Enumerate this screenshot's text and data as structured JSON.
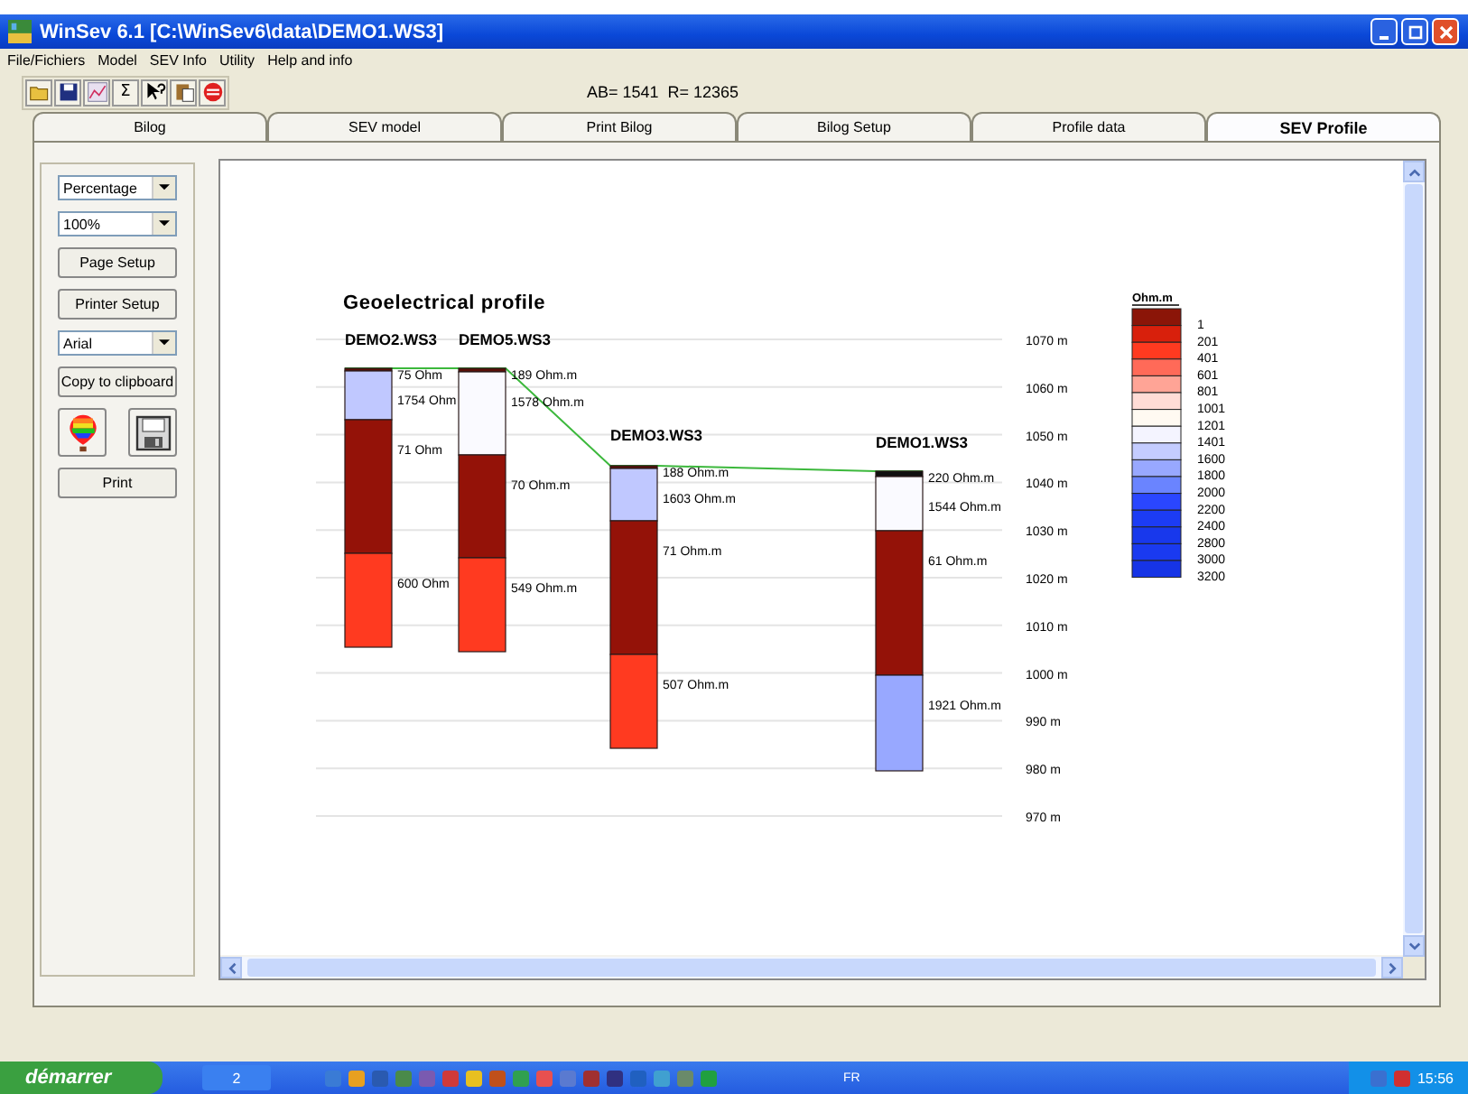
{
  "window": {
    "title": "WinSev 6.1 [C:\\WinSev6\\data\\DEMO1.WS3]"
  },
  "menu": [
    "File/Fichiers",
    "Model",
    "SEV Info",
    "Utility",
    "Help and info"
  ],
  "toolbar": {
    "sigma": "Σ",
    "readout": "AB= 1541  R= 12365"
  },
  "tabs": [
    {
      "label": "Bilog",
      "selected": false
    },
    {
      "label": "SEV model",
      "selected": false
    },
    {
      "label": "Print Bilog",
      "selected": false
    },
    {
      "label": "Bilog Setup",
      "selected": false
    },
    {
      "label": "Profile data",
      "selected": false
    },
    {
      "label": "SEV Profile",
      "selected": true
    }
  ],
  "side_panel": {
    "scale_mode": "Percentage",
    "zoom": "100%",
    "page_setup": "Page Setup",
    "printer_setup": "Printer Setup",
    "font": "Arial",
    "copy": "Copy to clipboard",
    "print": "Print"
  },
  "profile": {
    "title": "Geoelectrical profile",
    "soundings": [
      {
        "name": "DEMO2.WS3",
        "layers": [
          {
            "label": "75 Ohm",
            "color": "#5a1008"
          },
          {
            "label": "1754 Ohm",
            "color": "#c0c8ff"
          },
          {
            "label": "71 Ohm",
            "color": "#941208"
          },
          {
            "label": "600 Ohm",
            "color": "#ff3a20"
          }
        ]
      },
      {
        "name": "DEMO5.WS3",
        "layers": [
          {
            "label": "189 Ohm.m",
            "color": "#5a1008"
          },
          {
            "label": "1578 Ohm.m",
            "color": "#fafaff"
          },
          {
            "label": "70 Ohm.m",
            "color": "#941208"
          },
          {
            "label": "549 Ohm.m",
            "color": "#ff3a20"
          }
        ]
      },
      {
        "name": "DEMO3.WS3",
        "layers": [
          {
            "label": "188 Ohm.m",
            "color": "#5a1008"
          },
          {
            "label": "1603 Ohm.m",
            "color": "#c0c8ff"
          },
          {
            "label": "71 Ohm.m",
            "color": "#941208"
          },
          {
            "label": "507 Ohm.m",
            "color": "#ff3a20"
          }
        ]
      },
      {
        "name": "DEMO1.WS3",
        "layers": [
          {
            "label": "220 Ohm.m",
            "color": "#101010"
          },
          {
            "label": "1544 Ohm.m",
            "color": "#fafaff"
          },
          {
            "label": "61 Ohm.m",
            "color": "#941208"
          },
          {
            "label": "1921 Ohm.m",
            "color": "#98a8ff"
          }
        ]
      }
    ],
    "elevations": [
      "1070 m",
      "1060 m",
      "1050 m",
      "1040 m",
      "1030 m",
      "1020 m",
      "1010 m",
      "1000 m",
      "990 m",
      "980 m",
      "970 m"
    ],
    "legend": {
      "unit": "Ohm.m",
      "entries": [
        {
          "label": "1",
          "color": "#8b1508"
        },
        {
          "label": "201",
          "color": "#d8200c"
        },
        {
          "label": "401",
          "color": "#ff3a20"
        },
        {
          "label": "601",
          "color": "#ff6a58"
        },
        {
          "label": "801",
          "color": "#ffa496"
        },
        {
          "label": "1001",
          "color": "#ffdcd6"
        },
        {
          "label": "1201",
          "color": "#fffaf2"
        },
        {
          "label": "1401",
          "color": "#f4f4ff"
        },
        {
          "label": "1600",
          "color": "#c4ccff"
        },
        {
          "label": "1800",
          "color": "#98a8ff"
        },
        {
          "label": "2000",
          "color": "#6a84ff"
        },
        {
          "label": "2200",
          "color": "#2a46ff"
        },
        {
          "label": "2400",
          "color": "#1c3cf4"
        },
        {
          "label": "2800",
          "color": "#1838ec"
        },
        {
          "label": "3000",
          "color": "#1a3af0"
        },
        {
          "label": "3200",
          "color": "#1634e6"
        }
      ]
    }
  },
  "taskbar": {
    "start": "démarrer",
    "group": "2",
    "language": "FR",
    "clock": "15:56"
  }
}
